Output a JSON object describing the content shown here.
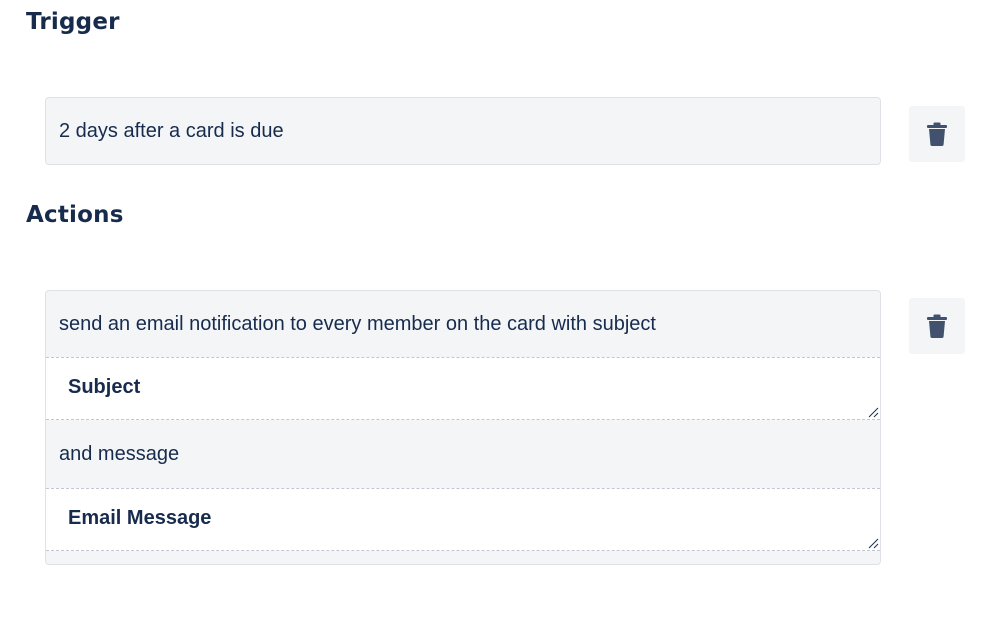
{
  "trigger": {
    "title": "Trigger",
    "text": "2 days after a card is due",
    "delete_icon": "trash-icon"
  },
  "actions": {
    "title": "Actions",
    "text_before_subject": "send an email notification to every member on the card with subject",
    "subject_placeholder": "Subject",
    "text_before_message": "and message",
    "message_placeholder": "Email Message",
    "delete_icon": "trash-icon"
  },
  "colors": {
    "text": "#172b4d",
    "card_bg": "#f4f5f7",
    "icon": "#42526e"
  }
}
